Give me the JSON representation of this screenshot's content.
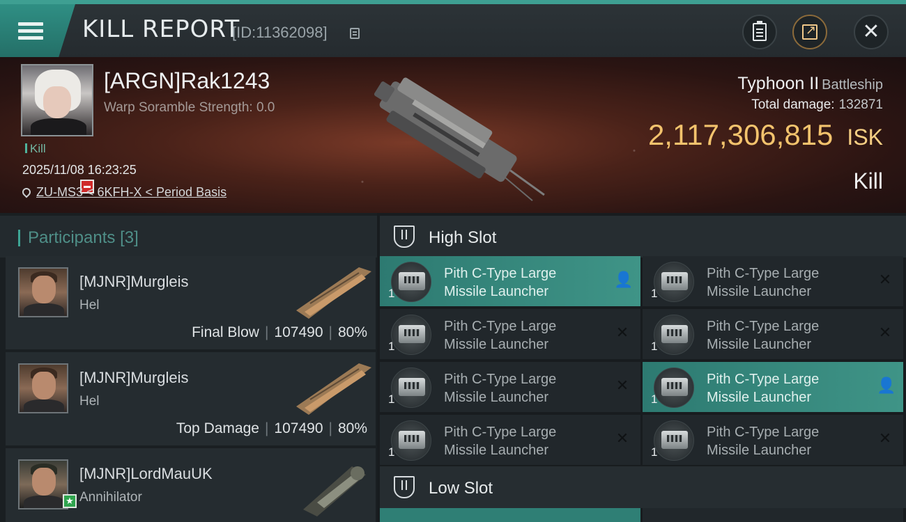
{
  "topbar": {
    "title": "KILL REPORT",
    "report_id": "[ID:11362098]"
  },
  "victim": {
    "name": "[ARGN]Rak1243",
    "warp_scramble": "Warp Soramble Strength: 0.0",
    "kill_tag": "Kill",
    "datetime": "2025/11/08 16:23:25",
    "location": "ZU-MS3 < 6KFH-X < Period Basis",
    "ship_name": "Typhoon II",
    "ship_class": "Battleship",
    "total_damage_label": "Total damage:",
    "total_damage": "132871",
    "isk_value": "2,117,306,815",
    "isk_unit": "ISK",
    "result": "Kill"
  },
  "participants": {
    "label": "Participants",
    "count": "[3]",
    "items": [
      {
        "name": "[MJNR]Murgleis",
        "ship": "Hel",
        "role": "Final Blow",
        "damage": "107490",
        "percent": "80%"
      },
      {
        "name": "[MJNR]Murgleis",
        "ship": "Hel",
        "role": "Top Damage",
        "damage": "107490",
        "percent": "80%"
      },
      {
        "name": "[MJNR]LordMauUK",
        "ship": "Annihilator",
        "role": "",
        "damage": "",
        "percent": ""
      }
    ]
  },
  "slots": {
    "high_label": "High Slot",
    "low_label": "Low Slot",
    "high_modules": [
      {
        "line1": "Pith C-Type Large",
        "line2": "Missile Launcher",
        "qty": "1",
        "status": "dropped"
      },
      {
        "line1": "Pith C-Type Large",
        "line2": "Missile Launcher",
        "qty": "1",
        "status": "destroyed"
      },
      {
        "line1": "Pith C-Type Large",
        "line2": "Missile Launcher",
        "qty": "1",
        "status": "destroyed"
      },
      {
        "line1": "Pith C-Type Large",
        "line2": "Missile Launcher",
        "qty": "1",
        "status": "destroyed"
      },
      {
        "line1": "Pith C-Type Large",
        "line2": "Missile Launcher",
        "qty": "1",
        "status": "destroyed"
      },
      {
        "line1": "Pith C-Type Large",
        "line2": "Missile Launcher",
        "qty": "1",
        "status": "dropped"
      },
      {
        "line1": "Pith C-Type Large",
        "line2": "Missile Launcher",
        "qty": "1",
        "status": "destroyed"
      },
      {
        "line1": "Pith C-Type Large",
        "line2": "Missile Launcher",
        "qty": "1",
        "status": "destroyed"
      }
    ]
  },
  "colors": {
    "accent": "#3ea595",
    "isk": "#f3c36d",
    "highlight_module": "#3f9487"
  },
  "icons": {
    "menu": "menu-icon",
    "copy": "copy-icon",
    "clipboard": "clipboard-icon",
    "share": "share-icon",
    "close": "close-icon",
    "location": "location-pin-icon",
    "slot": "slot-icon",
    "dropped": "person-icon",
    "destroyed": "x-icon"
  }
}
